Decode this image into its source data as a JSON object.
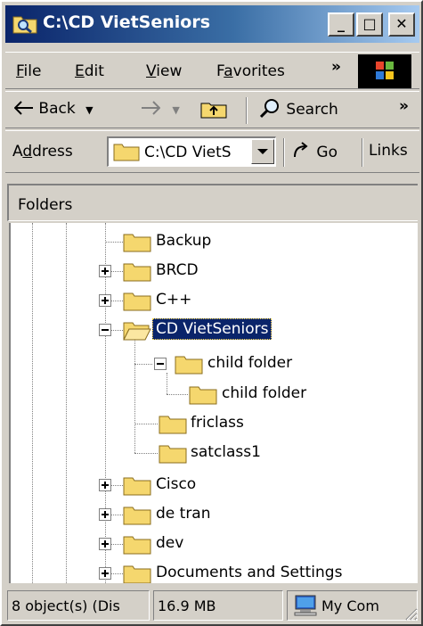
{
  "window": {
    "title": "C:\\CD VietSeniors",
    "controls": {
      "minimize": "_",
      "maximize": "□",
      "close": "✕"
    }
  },
  "menubar": {
    "items": [
      {
        "label": "File",
        "mnemonic": "F",
        "rest": "ile"
      },
      {
        "label": "Edit",
        "mnemonic": "E",
        "rest": "dit"
      },
      {
        "label": "View",
        "mnemonic": "V",
        "rest": "iew"
      },
      {
        "label": "Favorites",
        "prefix": "F",
        "mnemonic": "a",
        "rest": "vorites"
      }
    ],
    "overflow": "»"
  },
  "toolbar": {
    "back_label": "Back",
    "search_label": "Search",
    "overflow": "»"
  },
  "addressbar": {
    "label_prefix": "A",
    "label_mnemonic": "d",
    "label_rest": "dress",
    "value": "C:\\CD VietS",
    "go_label": "Go",
    "links_label": "Links"
  },
  "folders_pane": {
    "title": "Folders",
    "items": [
      {
        "label": "Backup"
      },
      {
        "label": "BRCD"
      },
      {
        "label": "C++"
      },
      {
        "label": "CD VietSeniors"
      },
      {
        "label": "child folder"
      },
      {
        "label": "child folder"
      },
      {
        "label": "friclass"
      },
      {
        "label": "satclass1"
      },
      {
        "label": "Cisco"
      },
      {
        "label": "de tran"
      },
      {
        "label": "dev"
      },
      {
        "label": "Documents and Settings"
      }
    ]
  },
  "statusbar": {
    "objects": "8 object(s) (Dis",
    "size": "16.9 MB",
    "location": "My Com"
  },
  "colors": {
    "title_active": "#0a246a",
    "face": "#d4d0c8",
    "folder": "#f5d76e",
    "selection": "#0a246a"
  },
  "icons": {
    "title": "folder-search-icon",
    "folder": "folder-icon",
    "open_folder": "open-folder-icon",
    "back": "back-arrow-icon",
    "forward": "forward-arrow-icon",
    "up": "folder-up-icon",
    "search": "search-icon",
    "go": "go-arrow-icon",
    "computer": "my-computer-icon",
    "windows_logo": "windows-logo-icon"
  }
}
